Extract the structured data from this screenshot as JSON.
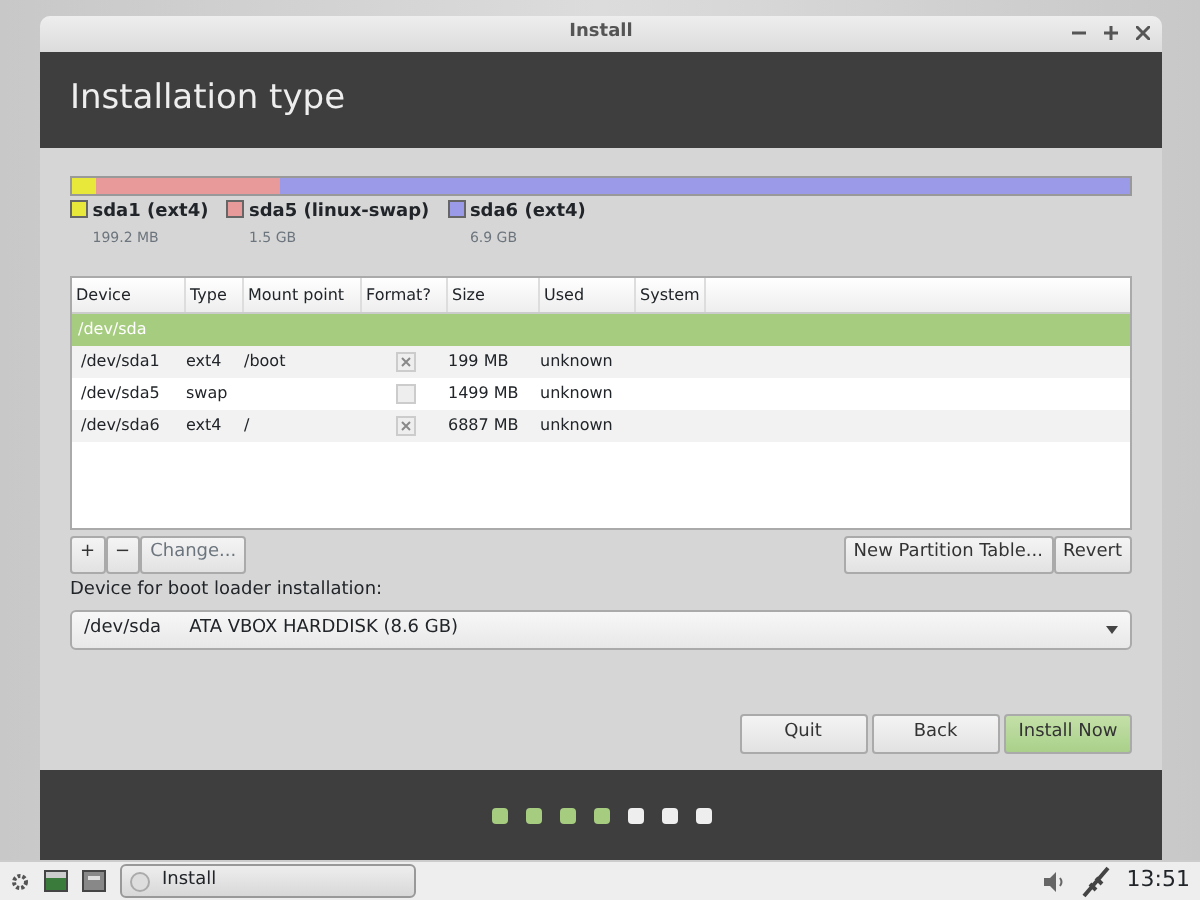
{
  "window": {
    "title": "Install"
  },
  "header": {
    "title": "Installation type"
  },
  "partitions": [
    {
      "name": "sda1 (ext4)",
      "size": "199.2 MB",
      "color": "#e8e83a"
    },
    {
      "name": "sda5 (linux-swap)",
      "size": "1.5 GB",
      "color": "#e89a9a"
    },
    {
      "name": "sda6 (ext4)",
      "size": "6.9 GB",
      "color": "#9a9ae8"
    }
  ],
  "table": {
    "columns": [
      "Device",
      "Type",
      "Mount point",
      "Format?",
      "Size",
      "Used",
      "System"
    ],
    "group": {
      "label": "/dev/sda",
      "selected": true
    },
    "rows": [
      {
        "device": "/dev/sda1",
        "type": "ext4",
        "mount": "/boot",
        "format": true,
        "size": "199 MB",
        "used": "unknown"
      },
      {
        "device": "/dev/sda5",
        "type": "swap",
        "mount": "",
        "format": false,
        "size": "1499 MB",
        "used": "unknown"
      },
      {
        "device": "/dev/sda6",
        "type": "ext4",
        "mount": "/",
        "format": true,
        "size": "6887 MB",
        "used": "unknown"
      }
    ]
  },
  "toolbar": {
    "add": "+",
    "remove": "−",
    "change": "Change...",
    "new_table": "New Partition Table...",
    "revert": "Revert"
  },
  "bootloader": {
    "label": "Device for boot loader installation:",
    "device": "/dev/sda",
    "description": "ATA VBOX HARDDISK (8.6 GB)"
  },
  "buttons": [
    {
      "label": "Quit",
      "primary": false
    },
    {
      "label": "Back",
      "primary": false
    },
    {
      "label": "Install Now",
      "primary": true
    }
  ],
  "steps": [
    {
      "done": true
    },
    {
      "done": true
    },
    {
      "done": true
    },
    {
      "done": true
    },
    {
      "done": false
    },
    {
      "done": false
    },
    {
      "done": false
    }
  ],
  "taskbar": {
    "task": "Install",
    "clock": "13:51"
  }
}
